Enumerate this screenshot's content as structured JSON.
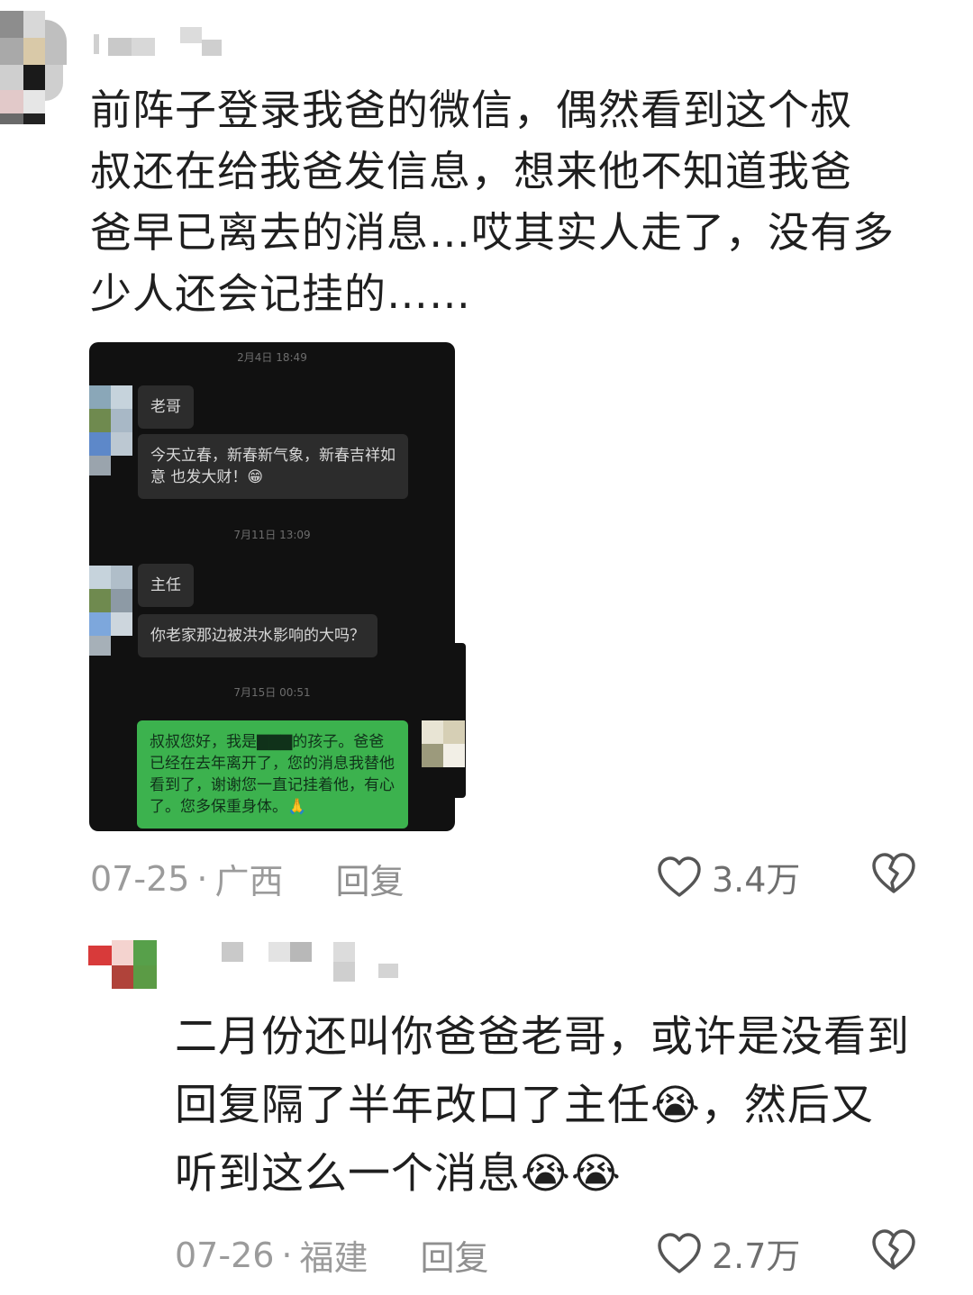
{
  "comments": [
    {
      "text_lines": [
        "前阵子登录我爸的微信，偶然看到这个叔",
        "叔还在给我爸发信息，想来他不知道我爸",
        "爸早已离去的消息…哎其实人走了，没有多",
        "少人还会记挂的……"
      ],
      "date": "07-25",
      "location": "广西",
      "reply_label": "回复",
      "likes": "3.4万"
    },
    {
      "text_lines": [
        "二月份还叫你爸爸老哥，或许是没看到",
        "回复隔了半年改口了主任😭，然后又",
        "听到这么一个消息😭😭"
      ],
      "date": "07-26",
      "location": "福建",
      "reply_label": "回复",
      "likes": "2.7万"
    }
  ],
  "meta_separator": "·",
  "chat": {
    "timestamps": [
      "2月4日 18:49",
      "7月11日 13:09",
      "7月15日 00:51"
    ],
    "messages": [
      {
        "side": "left",
        "text": "老哥"
      },
      {
        "side": "left",
        "text": "今天立春，新春新气象，新春吉祥如意 也发大财！😁"
      },
      {
        "side": "left",
        "text": "主任"
      },
      {
        "side": "left",
        "text": "你老家那边被洪水影响的大吗？"
      },
      {
        "side": "right",
        "text": "叔叔您好，我是▇▇▇的孩子。爸爸已经在去年离开了，您的消息我替他看到了，谢谢您一直记挂着他，有心了。您多保重身体。🙏"
      }
    ]
  },
  "colors": {
    "chat_bg": "#111111",
    "bubble_left": "#2c2c2c",
    "bubble_right": "#3cb24e",
    "meta_text": "#9b9b9b"
  },
  "icons": [
    "heart-outline-icon",
    "broken-heart-icon"
  ]
}
